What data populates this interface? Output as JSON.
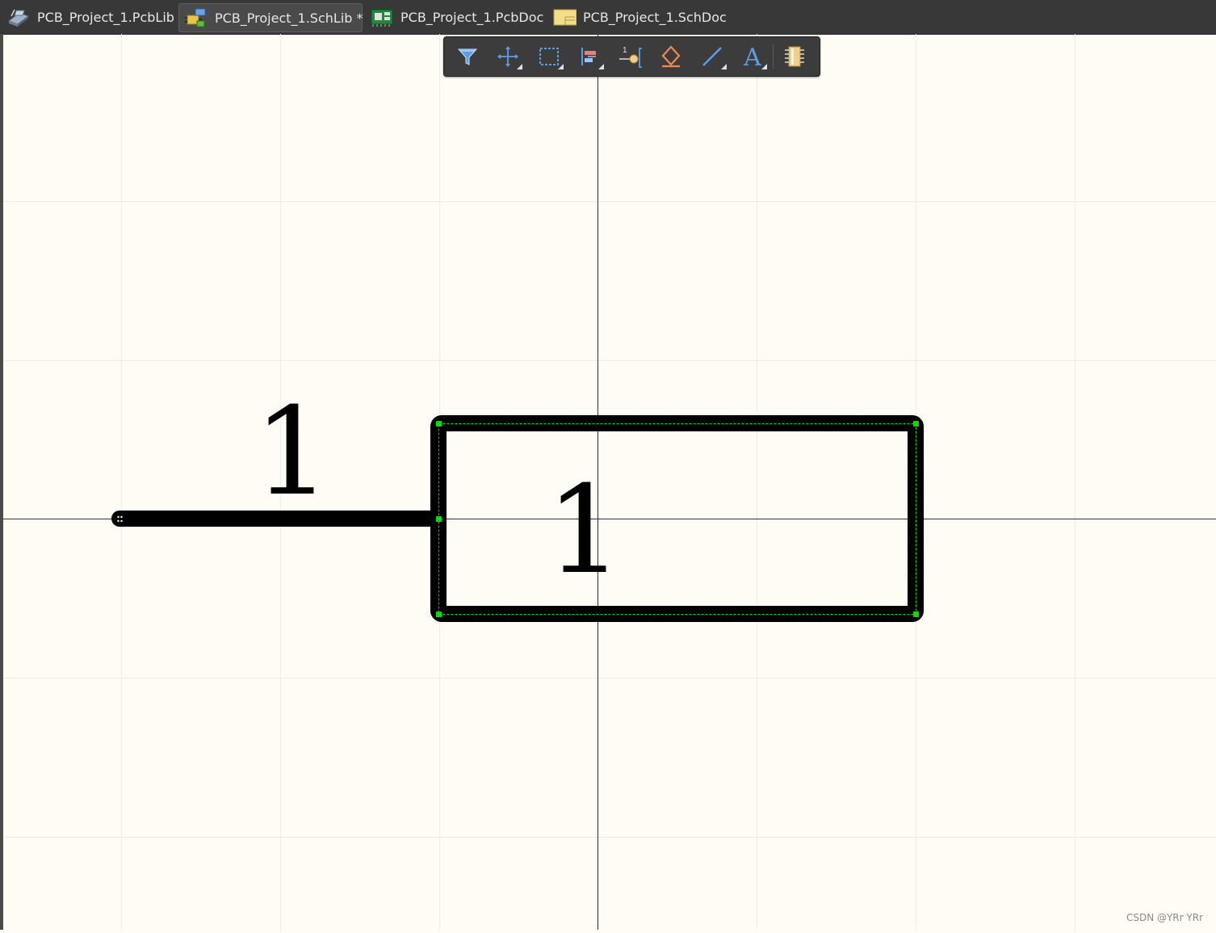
{
  "tabs": [
    {
      "label": "PCB_Project_1.PcbLib",
      "active": false
    },
    {
      "label": "PCB_Project_1.SchLib *",
      "active": true
    },
    {
      "label": "PCB_Project_1.PcbDoc",
      "active": false
    },
    {
      "label": "PCB_Project_1.SchDoc",
      "active": false
    }
  ],
  "toolbar": {
    "items": [
      "filter-icon",
      "move-icon",
      "select-rect-icon",
      "align-icon",
      "place-pin-icon",
      "ieee-symbol-icon",
      "place-line-icon",
      "place-text-icon",
      "component-icon"
    ]
  },
  "schematic": {
    "pin_designator": "1",
    "pin_name": "1"
  },
  "colors": {
    "sheet": "#fffcf6",
    "grid": "#efece5",
    "selection": "#00e000",
    "toolbar_blue": "#5b9ee8",
    "toolbar_orange": "#f08a4b"
  },
  "watermark": "CSDN @YRr YRr"
}
